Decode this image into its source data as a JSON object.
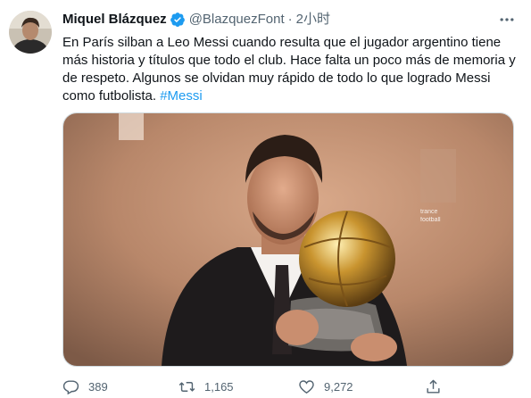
{
  "tweet": {
    "author": {
      "display_name": "Miquel Blázquez",
      "handle": "@BlazquezFont",
      "verified": true
    },
    "separator": "·",
    "time": "2小时",
    "text": {
      "body": "En París silban a Leo Messi cuando resulta que el jugador argentino tiene más historia y títulos que todo el club. Hace falta un poco más de memoria y de respeto. Algunos se olvidan muy rápido de todo lo que logrado Messi como futbolista. ",
      "hashtag": "#Messi"
    },
    "media": {
      "description_icon": "photo",
      "overlay_lines": [
        "trance",
        "football"
      ]
    },
    "actions": {
      "replies": "389",
      "retweets": "1,165",
      "likes": "9,272"
    }
  },
  "colors": {
    "accent": "#1d9bf0",
    "secondary_text": "#536471",
    "primary_text": "#0f1419",
    "border": "#cfd9de"
  }
}
